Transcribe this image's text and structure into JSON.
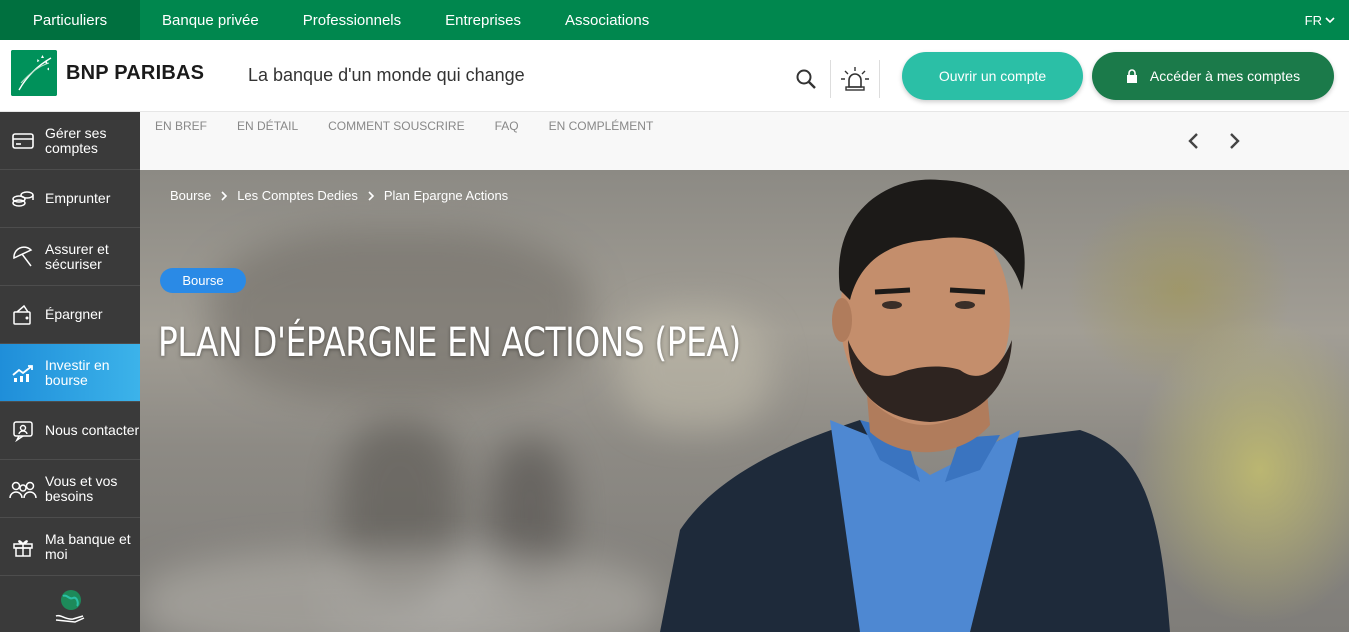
{
  "topnav": {
    "items": [
      "Particuliers",
      "Banque privée",
      "Professionnels",
      "Entreprises",
      "Associations"
    ],
    "language": "FR"
  },
  "header": {
    "logo_text": "BNP PARIBAS",
    "tagline": "La banque d'un monde qui change",
    "open_account": "Ouvrir un compte",
    "access_accounts": "Accéder à mes comptes"
  },
  "sidebar": {
    "items": [
      {
        "label": "Gérer ses comptes",
        "icon": "card-icon"
      },
      {
        "label": "Emprunter",
        "icon": "coins-icon"
      },
      {
        "label": "Assurer et sécuriser",
        "icon": "umbrella-icon"
      },
      {
        "label": "Épargner",
        "icon": "savings-icon"
      },
      {
        "label": "Investir en bourse",
        "icon": "chart-icon",
        "active": true
      },
      {
        "label": "Nous contacter",
        "icon": "contact-icon"
      },
      {
        "label": "Vous et vos besoins",
        "icon": "people-icon"
      },
      {
        "label": "Ma banque et moi",
        "icon": "gift-icon"
      }
    ]
  },
  "subnav": {
    "items": [
      "EN BREF",
      "EN DÉTAIL",
      "COMMENT SOUSCRIRE",
      "FAQ",
      "EN COMPLÉMENT"
    ]
  },
  "hero": {
    "breadcrumb": [
      "Bourse",
      "Les Comptes Dedies",
      "Plan Epargne Actions"
    ],
    "tag": "Bourse",
    "title": "PLAN D'ÉPARGNE EN ACTIONS (PEA)"
  },
  "colors": {
    "brand_green": "#00874e",
    "accent_teal": "#2bbfa6",
    "access_green": "#1b7a4a",
    "active_blue": "#2a8ae6"
  }
}
